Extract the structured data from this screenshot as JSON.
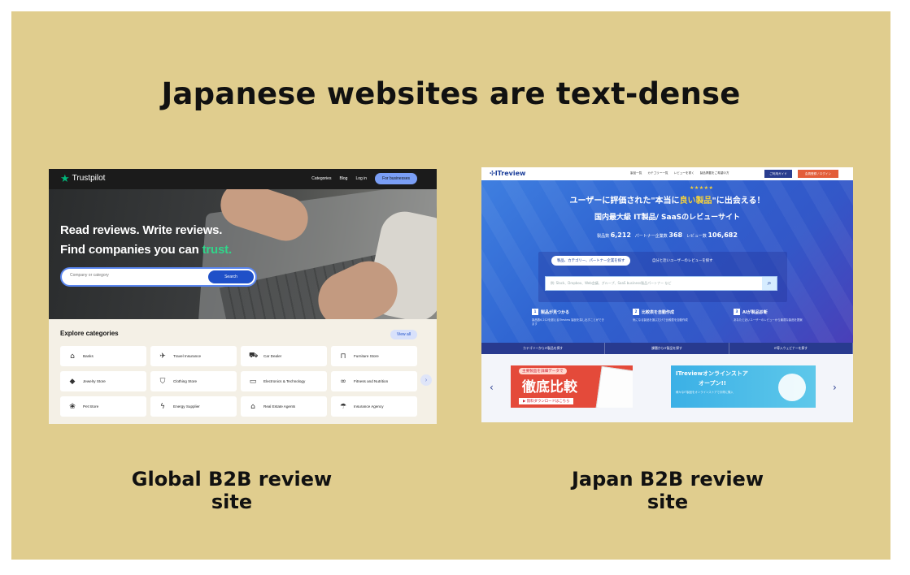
{
  "slide": {
    "headline": "Japanese websites are text-dense",
    "caption_left": "Global B2B review site",
    "caption_right": "Japan B2B review site",
    "background_color": "#e0cd8e"
  },
  "trustpilot": {
    "logo": "Trustpilot",
    "nav": [
      "Categories",
      "Blog",
      "Log in"
    ],
    "nav_button": "For businesses",
    "hero_line1": "Read reviews. Write reviews.",
    "hero_line2_prefix": "Find companies you can ",
    "hero_line2_accent": "trust.",
    "search_placeholder": "Company or category",
    "search_button": "Search",
    "explore_title": "Explore categories",
    "view_all": "View all",
    "categories": [
      {
        "label": "Banks",
        "icon": "bank-icon"
      },
      {
        "label": "Travel Insurance",
        "icon": "airplane-icon"
      },
      {
        "label": "Car Dealer",
        "icon": "car-icon"
      },
      {
        "label": "Furniture Store",
        "icon": "sofa-icon"
      },
      {
        "label": "Jewelry Store",
        "icon": "diamond-icon"
      },
      {
        "label": "Clothing Store",
        "icon": "shirt-icon"
      },
      {
        "label": "Electronics & Technology",
        "icon": "laptop-icon"
      },
      {
        "label": "Fitness and Nutrition",
        "icon": "dumbbell-icon"
      },
      {
        "label": "Pet Store",
        "icon": "paw-icon"
      },
      {
        "label": "Energy Supplier",
        "icon": "lightning-icon"
      },
      {
        "label": "Real Estate Agents",
        "icon": "house-icon"
      },
      {
        "label": "Insurance Agency",
        "icon": "umbrella-icon"
      }
    ],
    "accent_color": "#00b67a"
  },
  "itreview": {
    "logo": "ITreview",
    "nav": [
      "製品一覧",
      "カテゴリー一覧",
      "レビューを書く",
      "製品掲載をご希望の方"
    ],
    "nav_button1": "ご利用ガイド",
    "nav_button2": "会員登録 / ログイン",
    "stars": "★★★★★",
    "title_prefix": "ユーザーに評価された\"本当に",
    "title_highlight": "良い製品",
    "title_suffix": "\"に出会える！",
    "subtitle": "国内最大級 IT製品/ SaaSのレビューサイト",
    "stat1_label": "製品数",
    "stat1_value": "6,212",
    "stat2_label": "パートナー企業数",
    "stat2_value": "368",
    "stat3_label": "レビュー数",
    "stat3_value": "106,682",
    "tab1": "製品、カテゴリー、パートナー企業を探す",
    "tab2": "自分と近いユーザーのレビューを探す",
    "search_placeholder": "例: Slack、Dropbox、Web会議、グループ、SaaS business製品パートナー など",
    "features": [
      {
        "num": "1",
        "title": "製品が見つかる",
        "text": "製品数6,212を超えるITreview 製品を探し出すことができます"
      },
      {
        "num": "2",
        "title": "比較表を自動作成",
        "text": "気になる製品を選ぶだけで比較表を自動作成"
      },
      {
        "num": "3",
        "title": "AIが製品診断",
        "text": "あなたと近いユーザーのレビューから最適な製品を提案"
      }
    ],
    "category_bar": [
      "カテゴリーからIT製品を探す",
      "課題からIT製品を探す",
      "IT導入ウェビナーを探す"
    ],
    "banner1_top": "主要製品を詳細データで",
    "banner1_main": "徹底比較",
    "banner1_cta": "▶ 無料ダウンロードはこちら",
    "banner2_main": "ITreviewオンラインストア",
    "banner2_sub": "オープン!!",
    "banner2_text": "様々なIT製品をオンラインストアでお得に購入",
    "brand_color": "#2e62d0"
  }
}
